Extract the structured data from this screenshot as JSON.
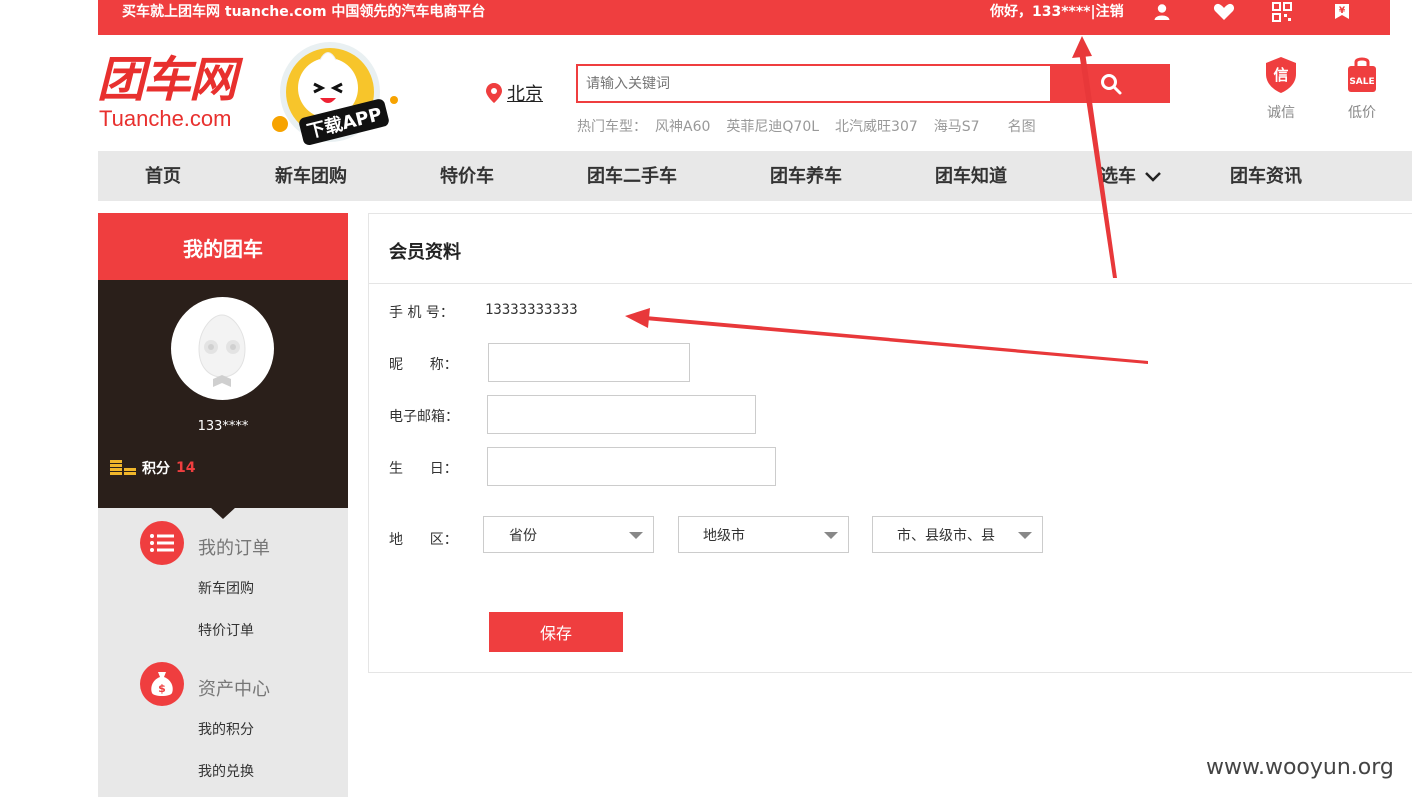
{
  "topbar": {
    "slogan": "买车就上团车网 tuanche.com 中国领先的汽车电商平台",
    "greeting": "你好，133****",
    "separator": "|",
    "logout": "注销"
  },
  "header": {
    "logo_cn": "团车网",
    "logo_en": "Tuanche.com",
    "app_label": "下载APP",
    "city": "北京",
    "search_placeholder": "请输入关键词",
    "hot_label": "热门车型：",
    "hot_models": [
      "风神A60",
      "英菲尼迪Q70L",
      "北汽威旺307",
      "海马S7",
      "名图"
    ],
    "badge_trust": "诚信",
    "badge_trust_icon_text": "信",
    "badge_lowprice": "低价",
    "badge_lowprice_icon_text": "SALE"
  },
  "nav": {
    "items": [
      "首页",
      "新车团购",
      "特价车",
      "团车二手车",
      "团车养车",
      "团车知道",
      "选车",
      "团车资讯"
    ]
  },
  "sidebar": {
    "title": "我的团车",
    "username": "133****",
    "points_label": "积分",
    "points_value": "14",
    "groups": [
      {
        "title": "我的订单",
        "items": [
          "新车团购",
          "特价订单"
        ]
      },
      {
        "title": "资产中心",
        "items": [
          "我的积分",
          "我的兑换"
        ]
      }
    ]
  },
  "profile": {
    "title": "会员资料",
    "phone_label": "手 机 号：",
    "phone_value": "13333333333",
    "nickname_label": "昵      称：",
    "email_label": "电子邮箱：",
    "birthday_label": "生      日：",
    "region_label": "地      区：",
    "province": "省份",
    "city": "地级市",
    "county": "市、县级市、县",
    "save": "保存"
  },
  "watermark": "www.wooyun.org",
  "colors": {
    "brand_red": "#ef3e3f",
    "sidebar_dark": "#2a1f1a",
    "nav_gray": "#e8e8e8"
  }
}
